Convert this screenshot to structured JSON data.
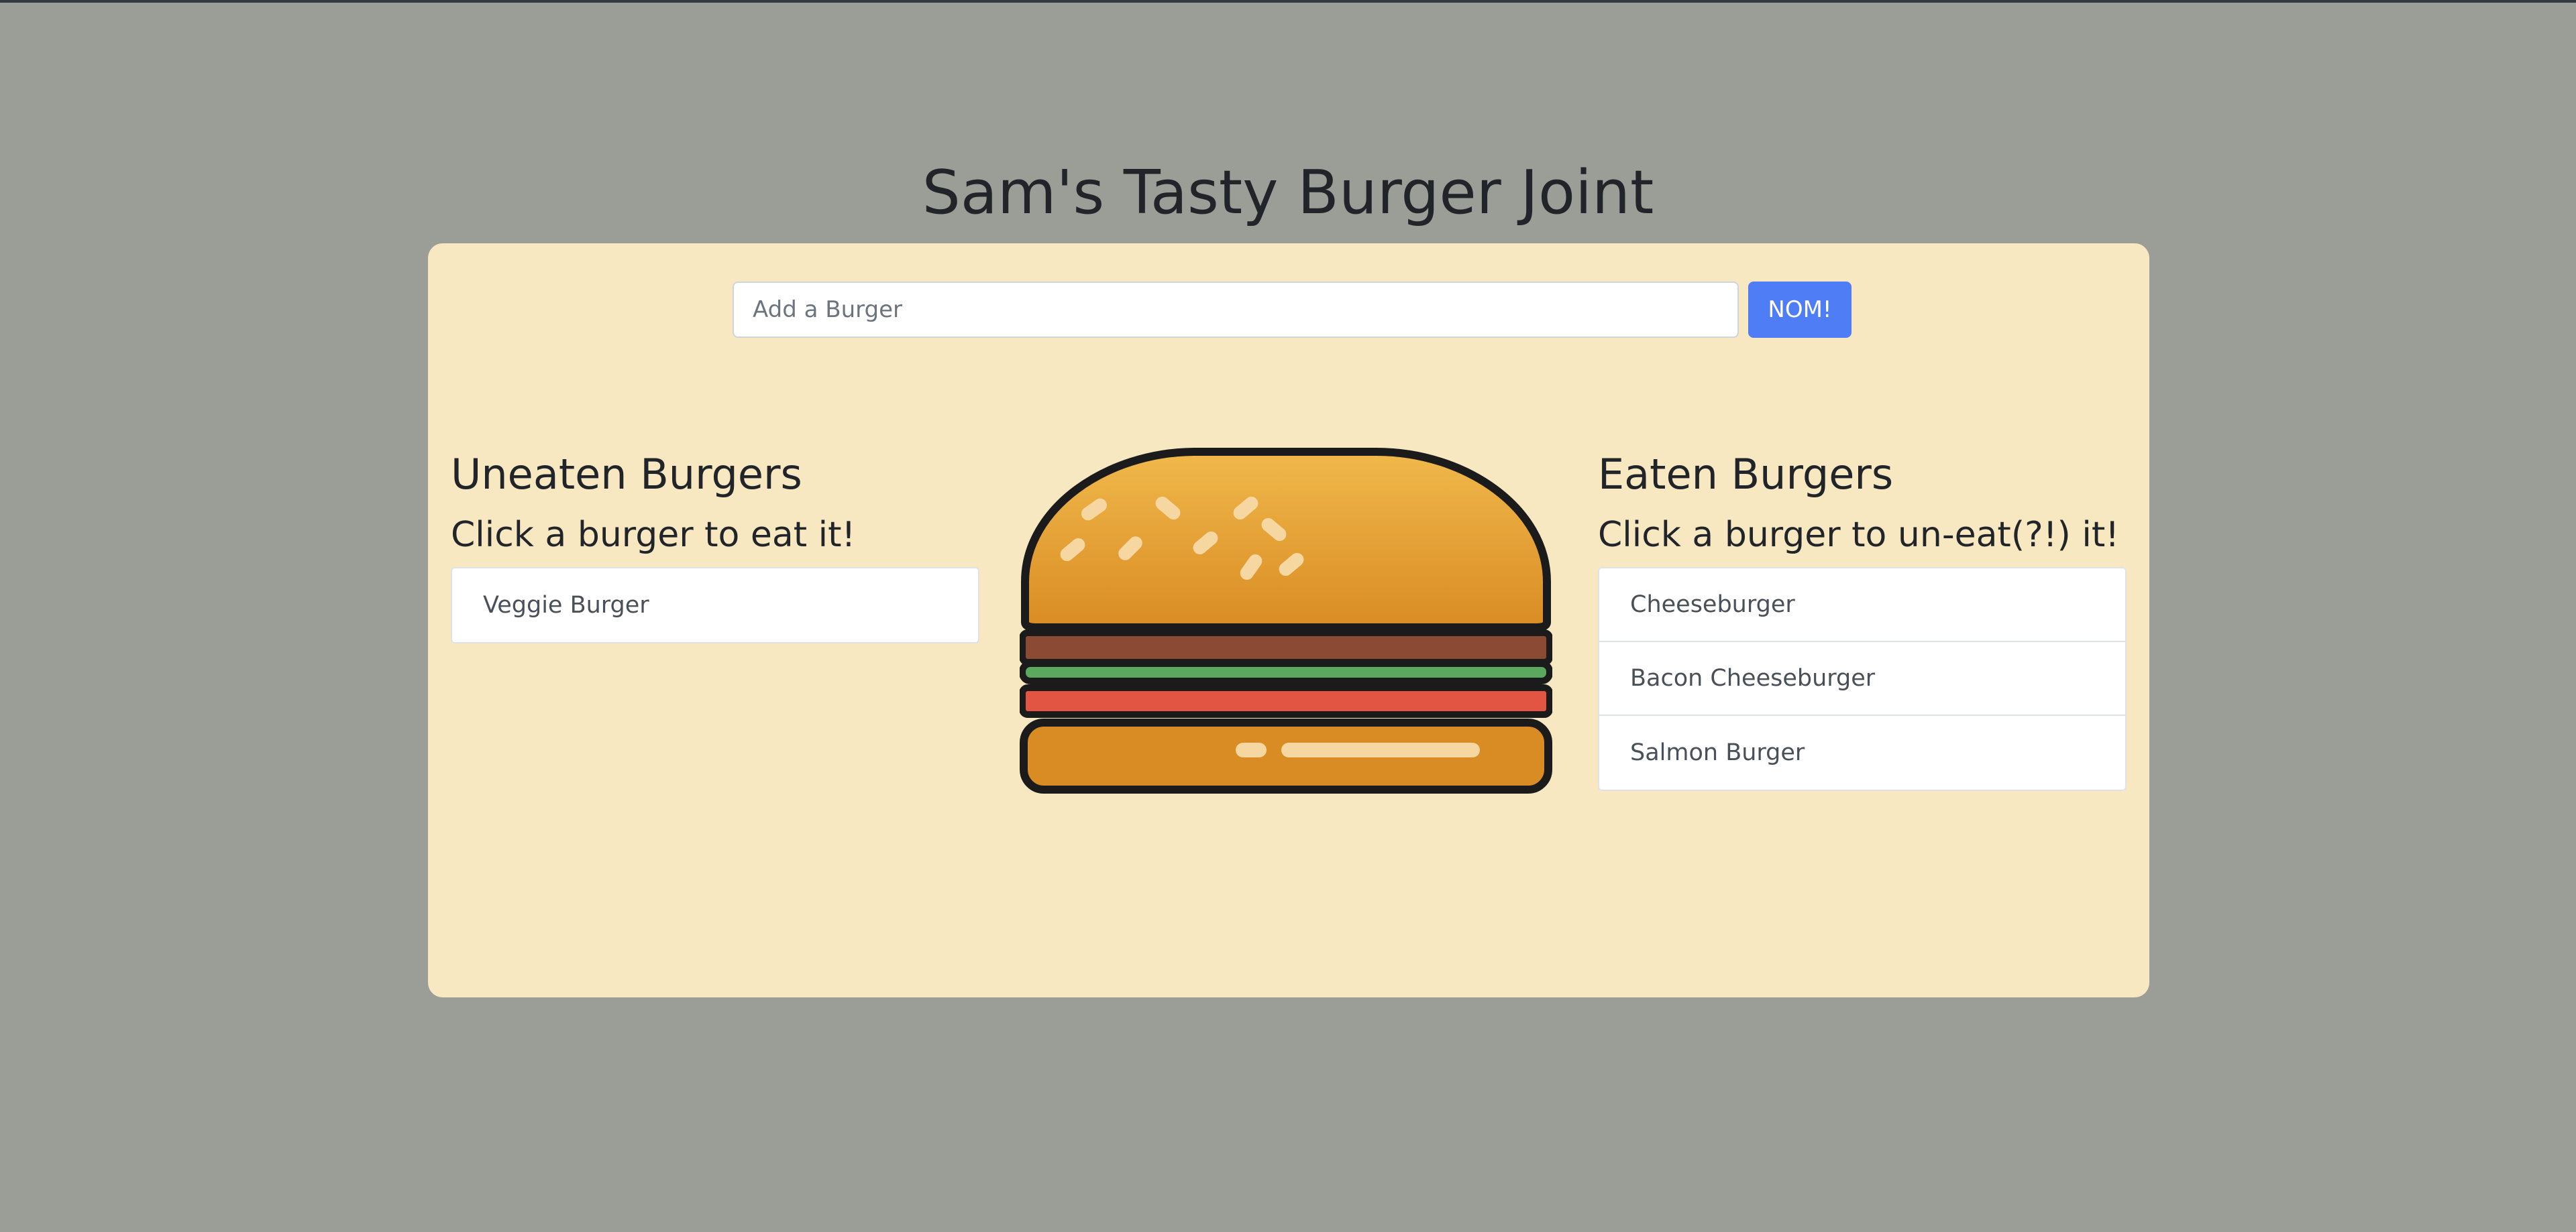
{
  "page": {
    "title": "Sam's Tasty Burger Joint"
  },
  "form": {
    "placeholder": "Add a Burger",
    "value": "",
    "submit_label": "NOM!"
  },
  "uneaten": {
    "heading": "Uneaten Burgers",
    "subheading": "Click a burger to eat it!",
    "items": [
      "Veggie Burger"
    ]
  },
  "eaten": {
    "heading": "Eaten Burgers",
    "subheading": "Click a burger to un-eat(?!) it!",
    "items": [
      "Cheeseburger",
      "Bacon Cheeseburger",
      "Salmon Burger"
    ]
  },
  "image": {
    "icon": "burger-illustration"
  },
  "colors": {
    "background": "#9b9e97",
    "card": "#f8e8c2",
    "button": "#4f7df5",
    "bun": "#e3a337",
    "patty": "#8a4a34",
    "lettuce": "#5aa95f",
    "tomato": "#e25543"
  }
}
